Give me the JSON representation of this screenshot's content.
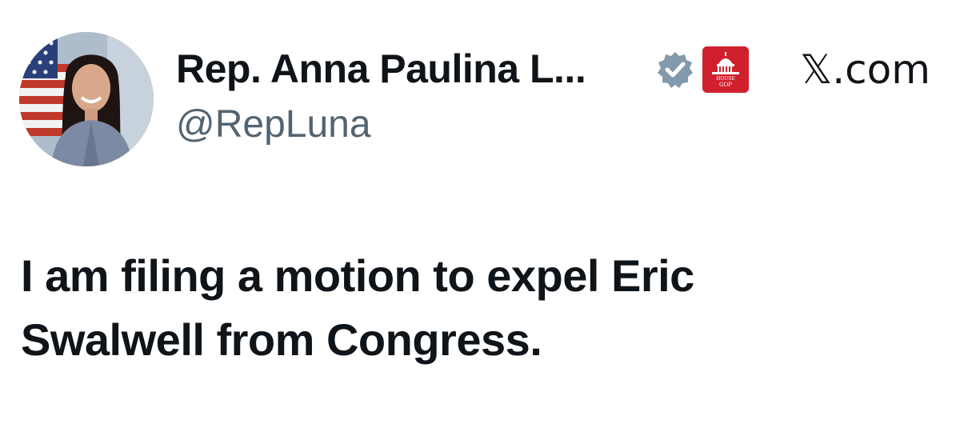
{
  "tweet": {
    "author": {
      "display_name": "Rep. Anna Paulina L...",
      "handle": "@RepLuna",
      "avatar_icon": "profile-photo",
      "verified_icon": "verified-badge-icon",
      "verified_color": "#829aab",
      "affiliation_icon": "house-gop-logo",
      "affiliation_text": [
        "HOUSE",
        "GOP"
      ],
      "affiliation_color": "#d0202e"
    },
    "brand": {
      "label": "𝕏.com"
    },
    "text_lines": [
      "I am filing a motion to expel Eric",
      "Swalwell from Congress."
    ]
  }
}
